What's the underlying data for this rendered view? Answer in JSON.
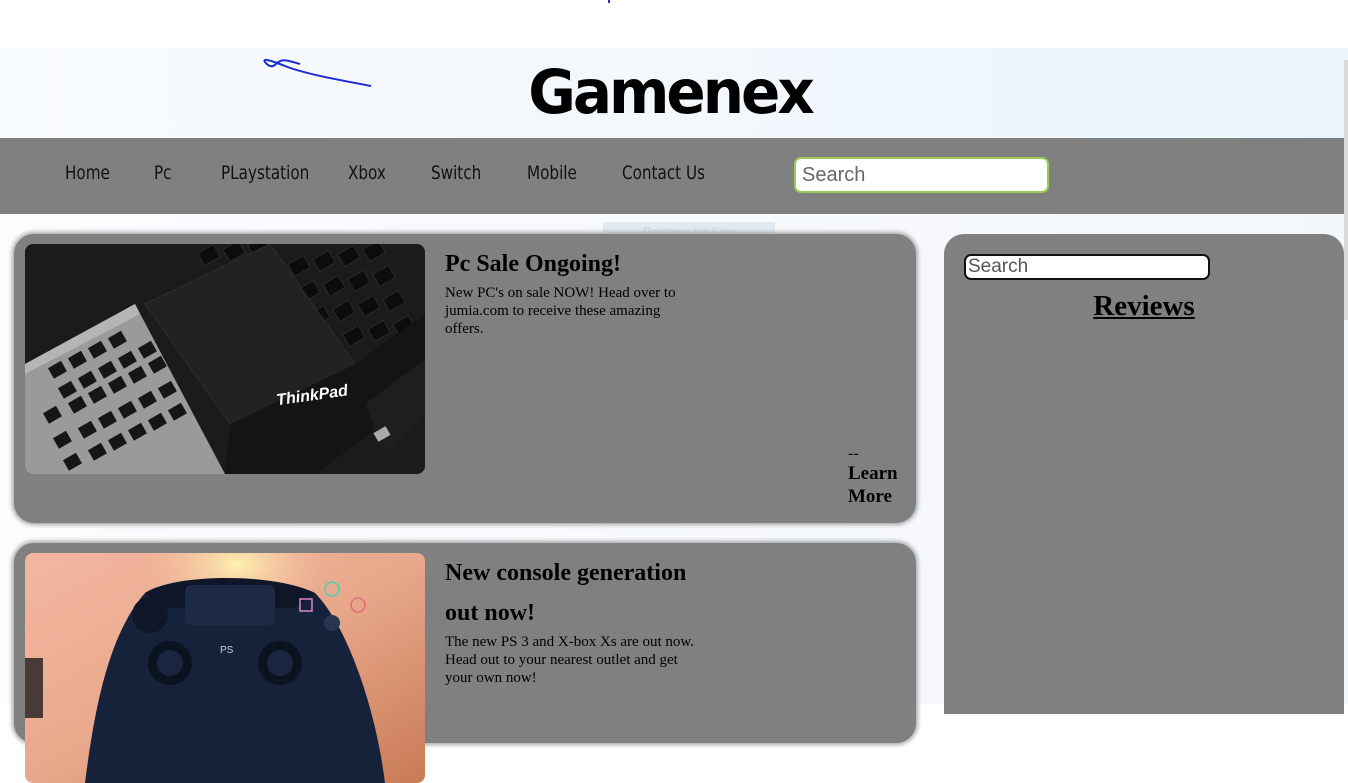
{
  "header": {
    "logo": "Gamenex"
  },
  "nav": {
    "items": [
      "Home",
      "Pc",
      "PLaystation",
      "Xbox",
      "Switch",
      "Mobile",
      "Contact Us"
    ],
    "search_placeholder": "Search"
  },
  "overlay_ghost": "Rectangular Snip",
  "posts": [
    {
      "title": "Pc Sale Ongoing!",
      "text": "New PC's on sale NOW! Head over to jumia.com to receive these amazing offers.",
      "image_label": "ThinkPad",
      "link_dash": "--",
      "link_label": "Learn More"
    },
    {
      "title": "New console generation out now!",
      "text": "The new PS 3 and X-box Xs are out now. Head out to your nearest outlet and get your own now!"
    }
  ],
  "sidebar": {
    "search_placeholder": "Search",
    "heading": "Reviews"
  },
  "colors": {
    "navbar": "#808080",
    "card": "#808080",
    "search_border": "#9acd55",
    "scribble": "#1d2bd1"
  }
}
